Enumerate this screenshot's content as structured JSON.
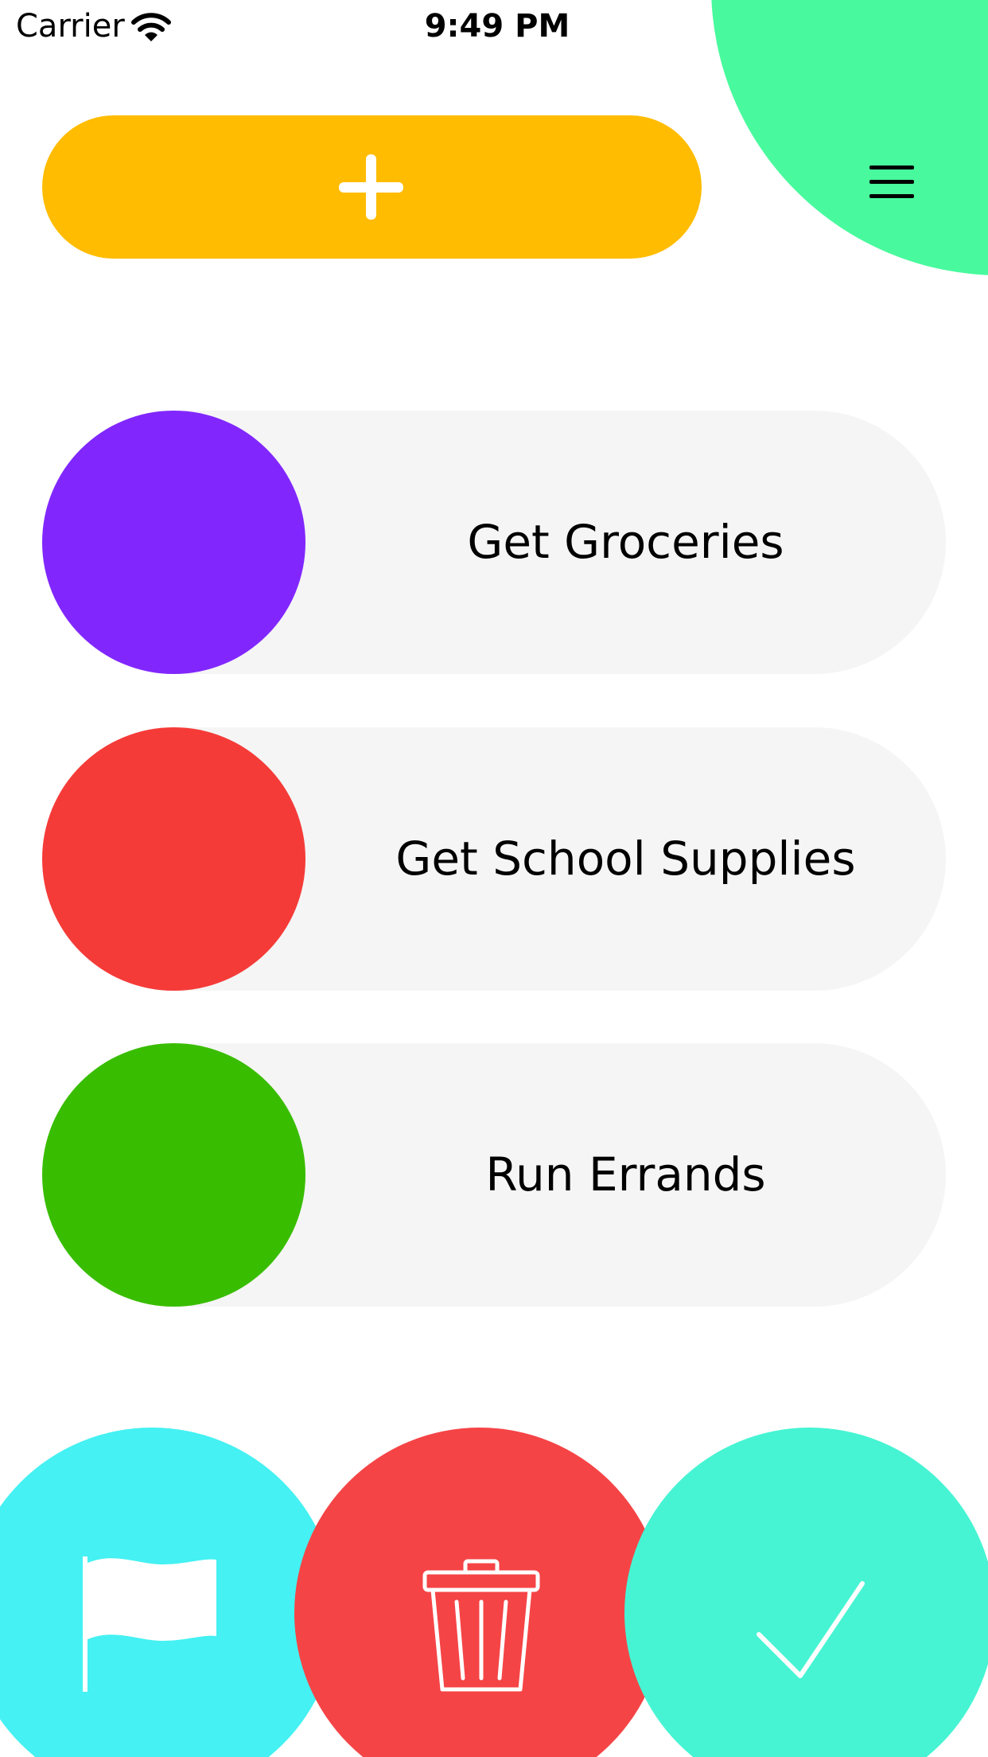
{
  "status_bar": {
    "carrier": "Carrier",
    "time": "9:49 PM",
    "wifi_icon": "wifi-icon",
    "battery_icon": "battery-icon"
  },
  "header": {
    "add_icon": "plus-icon",
    "add_color": "#ffbc00",
    "menu_icon": "hamburger-menu-icon",
    "menu_color": "#48fa9d"
  },
  "tasks": [
    {
      "label": "Get Groceries",
      "color": "#8127fd"
    },
    {
      "label": "Get School Supplies",
      "color": "#f53b38"
    },
    {
      "label": "Run Errands",
      "color": "#39bd00"
    }
  ],
  "actions": [
    {
      "icon": "flag-icon",
      "color": "#45f1f2"
    },
    {
      "icon": "trash-icon",
      "color": "#f54446"
    },
    {
      "icon": "checkmark-icon",
      "color": "#46f4d3"
    }
  ]
}
